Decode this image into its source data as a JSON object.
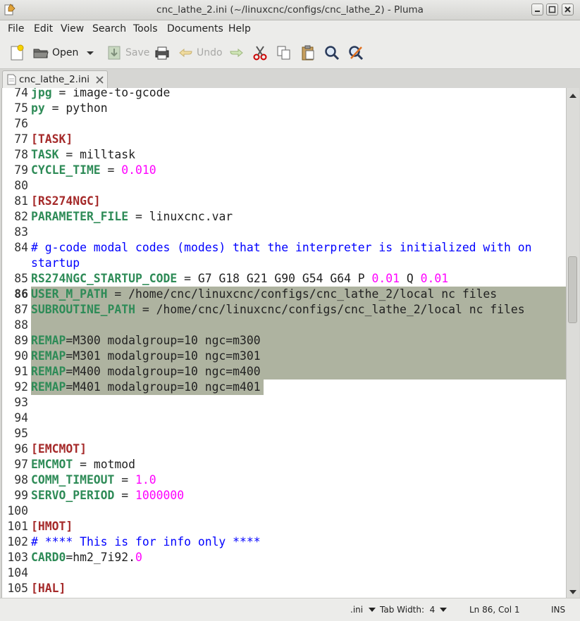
{
  "window": {
    "title": "cnc_lathe_2.ini (~/linuxcnc/configs/cnc_lathe_2) - Pluma"
  },
  "menu": [
    "File",
    "Edit",
    "View",
    "Search",
    "Tools",
    "Documents",
    "Help"
  ],
  "toolbar": {
    "open_label": "Open",
    "save_label": "Save",
    "undo_label": "Undo"
  },
  "tab": {
    "label": "cnc_lathe_2.ini"
  },
  "editor": {
    "cursor_line": 86,
    "lines": [
      {
        "n": "74",
        "tokens": [
          {
            "t": "jpg",
            "c": "key"
          },
          {
            "t": " = image-to-gcode",
            "c": "txt"
          }
        ]
      },
      {
        "n": "75",
        "tokens": [
          {
            "t": "py",
            "c": "key"
          },
          {
            "t": " = python",
            "c": "txt"
          }
        ]
      },
      {
        "n": "76",
        "tokens": []
      },
      {
        "n": "77",
        "tokens": [
          {
            "t": "[TASK]",
            "c": "sec"
          }
        ]
      },
      {
        "n": "78",
        "tokens": [
          {
            "t": "TASK",
            "c": "key"
          },
          {
            "t": " = milltask",
            "c": "txt"
          }
        ]
      },
      {
        "n": "79",
        "tokens": [
          {
            "t": "CYCLE_TIME",
            "c": "key"
          },
          {
            "t": " = ",
            "c": "txt"
          },
          {
            "t": "0.010",
            "c": "num"
          }
        ]
      },
      {
        "n": "80",
        "tokens": []
      },
      {
        "n": "81",
        "tokens": [
          {
            "t": "[RS274NGC]",
            "c": "sec"
          }
        ]
      },
      {
        "n": "82",
        "tokens": [
          {
            "t": "PARAMETER_FILE",
            "c": "key"
          },
          {
            "t": " = linuxcnc.var",
            "c": "txt"
          }
        ]
      },
      {
        "n": "83",
        "tokens": []
      },
      {
        "n": "84",
        "tokens": [
          {
            "t": "# g-code modal codes (modes) that the interpreter is initialized with on",
            "c": "com"
          }
        ]
      },
      {
        "n": "",
        "tokens": [
          {
            "t": "startup",
            "c": "com"
          }
        ]
      },
      {
        "n": "85",
        "tokens": [
          {
            "t": "RS274NGC_STARTUP_CODE",
            "c": "key"
          },
          {
            "t": " = G7 G18 G21 G90 G54 G64 P ",
            "c": "txt"
          },
          {
            "t": "0.01",
            "c": "num"
          },
          {
            "t": " Q ",
            "c": "txt"
          },
          {
            "t": "0.01",
            "c": "num"
          }
        ]
      },
      {
        "n": "86",
        "tokens": [
          {
            "t": "USER_M_PATH",
            "c": "key"
          },
          {
            "t": " = /home/cnc/linuxcnc/configs/cnc_lathe_2/local nc files",
            "c": "txt"
          }
        ]
      },
      {
        "n": "87",
        "tokens": [
          {
            "t": "SUBROUTINE_PATH",
            "c": "key"
          },
          {
            "t": " = /home/cnc/linuxcnc/configs/cnc_lathe_2/local nc files",
            "c": "txt"
          }
        ]
      },
      {
        "n": "88",
        "tokens": []
      },
      {
        "n": "89",
        "tokens": [
          {
            "t": "REMAP",
            "c": "key"
          },
          {
            "t": "=M300 modalgroup=10 ngc=m300",
            "c": "txt"
          }
        ]
      },
      {
        "n": "90",
        "tokens": [
          {
            "t": "REMAP",
            "c": "key"
          },
          {
            "t": "=M301 modalgroup=10 ngc=m301",
            "c": "txt"
          }
        ]
      },
      {
        "n": "91",
        "tokens": [
          {
            "t": "REMAP",
            "c": "key"
          },
          {
            "t": "=M400 modalgroup=10 ngc=m400",
            "c": "txt"
          }
        ]
      },
      {
        "n": "92",
        "tokens": [
          {
            "t": "REMAP",
            "c": "key"
          },
          {
            "t": "=M401 modalgroup=10 ngc=m401",
            "c": "txt"
          }
        ]
      },
      {
        "n": "93",
        "tokens": []
      },
      {
        "n": "94",
        "tokens": []
      },
      {
        "n": "95",
        "tokens": []
      },
      {
        "n": "96",
        "tokens": [
          {
            "t": "[EMCMOT]",
            "c": "sec"
          }
        ]
      },
      {
        "n": "97",
        "tokens": [
          {
            "t": "EMCMOT",
            "c": "key"
          },
          {
            "t": " = motmod",
            "c": "txt"
          }
        ]
      },
      {
        "n": "98",
        "tokens": [
          {
            "t": "COMM_TIMEOUT",
            "c": "key"
          },
          {
            "t": " = ",
            "c": "txt"
          },
          {
            "t": "1.0",
            "c": "num"
          }
        ]
      },
      {
        "n": "99",
        "tokens": [
          {
            "t": "SERVO_PERIOD",
            "c": "key"
          },
          {
            "t": " = ",
            "c": "txt"
          },
          {
            "t": "1000000",
            "c": "num"
          }
        ]
      },
      {
        "n": "100",
        "tokens": []
      },
      {
        "n": "101",
        "tokens": [
          {
            "t": "[HMOT]",
            "c": "sec"
          }
        ]
      },
      {
        "n": "102",
        "tokens": [
          {
            "t": "# **** This is for info only ****",
            "c": "com"
          }
        ]
      },
      {
        "n": "103",
        "tokens": [
          {
            "t": "CARD0",
            "c": "key"
          },
          {
            "t": "=hm2_7i92.",
            "c": "txt"
          },
          {
            "t": "0",
            "c": "num"
          }
        ]
      },
      {
        "n": "104",
        "tokens": []
      },
      {
        "n": "105",
        "tokens": [
          {
            "t": "[HAL]",
            "c": "sec"
          }
        ]
      }
    ]
  },
  "statusbar": {
    "language": ".ini",
    "tab_width": "Tab Width:  4",
    "position": "Ln 86, Col 1",
    "mode": "INS"
  },
  "colors": {
    "section": "#a52a2a",
    "key": "#2e8b57",
    "number": "#ff00ff",
    "comment": "#0000ff",
    "selection": "#aeb3a0"
  }
}
